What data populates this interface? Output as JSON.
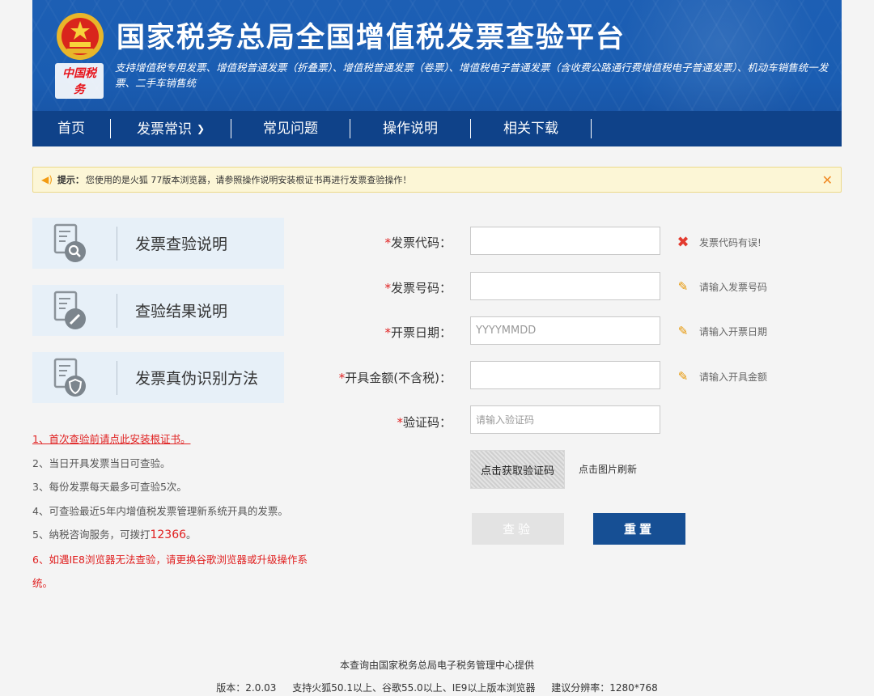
{
  "header": {
    "title": "国家税务总局全国增值税发票查验平台",
    "subtitle": "支持增值税专用发票、增值税普通发票（折叠票）、增值税普通发票（卷票）、增值税电子普通发票（含收费公路通行费增值税电子普通发票）、机动车销售统一发票、二手车销售统",
    "seal_text": "中国税务",
    "nav": [
      {
        "label": "首页"
      },
      {
        "label": "发票常识"
      },
      {
        "label": "常见问题"
      },
      {
        "label": "操作说明"
      },
      {
        "label": "相关下载"
      }
    ]
  },
  "notice": {
    "prefix": "提示：",
    "text": "您使用的是火狐 77版本浏览器，请参照操作说明安装根证书再进行发票查验操作！",
    "close": "✕"
  },
  "cards": [
    {
      "label": "发票查验说明",
      "icon": "search-document-icon"
    },
    {
      "label": "查验结果说明",
      "icon": "edit-document-icon"
    },
    {
      "label": "发票真伪识别方法",
      "icon": "shield-document-icon"
    }
  ],
  "notes": [
    "1、首次查验前请点此安装根证书。",
    "2、当日开具发票当日可查验。",
    "3、每份发票每天最多可查验5次。",
    "4、可查验最近5年内增值税发票管理新系统开具的发票。",
    "5、纳税咨询服务，可拨打",
    "12366",
    "。",
    "6、如遇IE8浏览器无法查验，请更换谷歌浏览器或升级操作系统。"
  ],
  "form": {
    "star": "*",
    "fields": [
      {
        "label": "发票代码：",
        "value": "",
        "placeholder": "",
        "hint": "发票代码有误!",
        "hint_icon": "error-x-icon"
      },
      {
        "label": "发票号码：",
        "value": "",
        "placeholder": "",
        "hint": "请输入发票号码",
        "hint_icon": "pencil-icon"
      },
      {
        "label": "开票日期：",
        "value": "",
        "placeholder": "YYYYMMDD",
        "hint": "请输入开票日期",
        "hint_icon": "pencil-icon"
      },
      {
        "label": "开具金额(不含税)：",
        "value": "",
        "placeholder": "",
        "hint": "请输入开具金额",
        "hint_icon": "pencil-icon"
      },
      {
        "label": "验证码：",
        "value": "",
        "placeholder": "请输入验证码"
      }
    ],
    "captcha_text": "点击获取验证码",
    "captcha_refresh": "点击图片刷新",
    "check_button": "查验",
    "reset_button": "重置"
  },
  "footer": {
    "line1": "本查询由国家税务总局电子税务管理中心提供",
    "version": "版本：2.0.03",
    "browsers": "支持火狐50.1以上、谷歌55.0以上、IE9以上版本浏览器",
    "resolution": "建议分辨率：1280*768"
  },
  "colors": {
    "header_blue": "#1a5db2",
    "nav_blue": "#0f4289",
    "reset_button": "#164f94",
    "required_star": "#e02020",
    "notice_bg": "#fcf6d6"
  }
}
